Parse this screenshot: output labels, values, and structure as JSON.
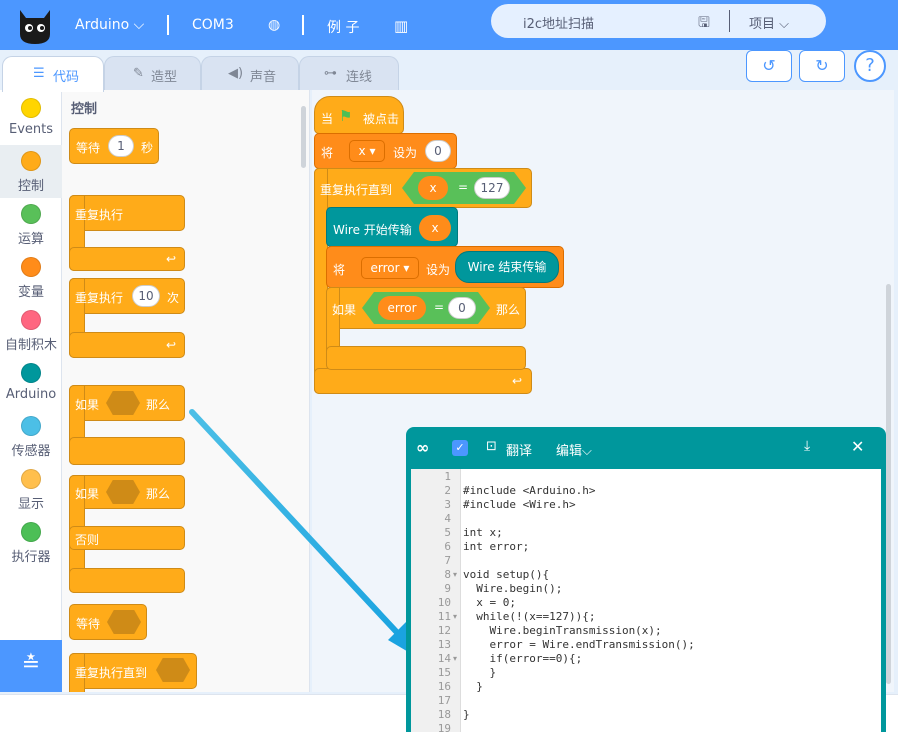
{
  "topbar": {
    "board": "Arduino",
    "port": "COM3",
    "examples": "例 子",
    "project_name": "i2c地址扫描",
    "project_menu": "项目"
  },
  "tabs": [
    {
      "label": "代码",
      "icon": "code-icon"
    },
    {
      "label": "造型",
      "icon": "brush-icon"
    },
    {
      "label": "声音",
      "icon": "speaker-icon"
    },
    {
      "label": "连线",
      "icon": "wire-icon"
    }
  ],
  "categories": [
    {
      "label": "Events",
      "color": "#ffd500"
    },
    {
      "label": "控制",
      "color": "#ffab19"
    },
    {
      "label": "运算",
      "color": "#59c059"
    },
    {
      "label": "变量",
      "color": "#ff8c1a"
    },
    {
      "label": "自制积木",
      "color": "#ff6680"
    },
    {
      "label": "Arduino",
      "color": "#00979c"
    },
    {
      "label": "传感器",
      "color": "#4cbfe6"
    },
    {
      "label": "显示",
      "color": "#ffbf4d"
    },
    {
      "label": "执行器",
      "color": "#4cbf56"
    }
  ],
  "palette": {
    "title": "控制",
    "wait": "等待",
    "wait_value": "1",
    "seconds": "秒",
    "forever": "重复执行",
    "repeat": "重复执行",
    "repeat_value": "10",
    "times": "次",
    "if": "如果",
    "then": "那么",
    "else": "否则",
    "wait_until": "等待",
    "repeat_until": "重复执行直到"
  },
  "script": {
    "when": "当",
    "clicked": "被点击",
    "set": "将",
    "var_x": "x",
    "set_to": "设为",
    "zero": "0",
    "repeat_until": "重复执行直到",
    "eq": "=",
    "val_127": "127",
    "wire_begin": "Wire 开始传输",
    "var_error": "error",
    "wire_end": "Wire 结束传输",
    "if": "如果",
    "then": "那么"
  },
  "codepanel": {
    "translate": "翻译",
    "edit": "编辑",
    "lines": [
      {
        "n": "1",
        "code": ""
      },
      {
        "n": "2",
        "code": "#include <Arduino.h>"
      },
      {
        "n": "3",
        "code": "#include <Wire.h>"
      },
      {
        "n": "4",
        "code": ""
      },
      {
        "n": "5",
        "code": "int x;"
      },
      {
        "n": "6",
        "code": "int error;"
      },
      {
        "n": "7",
        "code": ""
      },
      {
        "n": "8",
        "code": "void setup(){"
      },
      {
        "n": "9",
        "code": "  Wire.begin();"
      },
      {
        "n": "10",
        "code": "  x = 0;"
      },
      {
        "n": "11",
        "code": "  while(!(x==127)){;"
      },
      {
        "n": "12",
        "code": "    Wire.beginTransmission(x);"
      },
      {
        "n": "13",
        "code": "    error = Wire.endTransmission();"
      },
      {
        "n": "14",
        "code": "    if(error==0){;"
      },
      {
        "n": "15",
        "code": "    }"
      },
      {
        "n": "16",
        "code": "  }"
      },
      {
        "n": "17",
        "code": ""
      },
      {
        "n": "18",
        "code": "}"
      },
      {
        "n": "19",
        "code": ""
      }
    ]
  }
}
